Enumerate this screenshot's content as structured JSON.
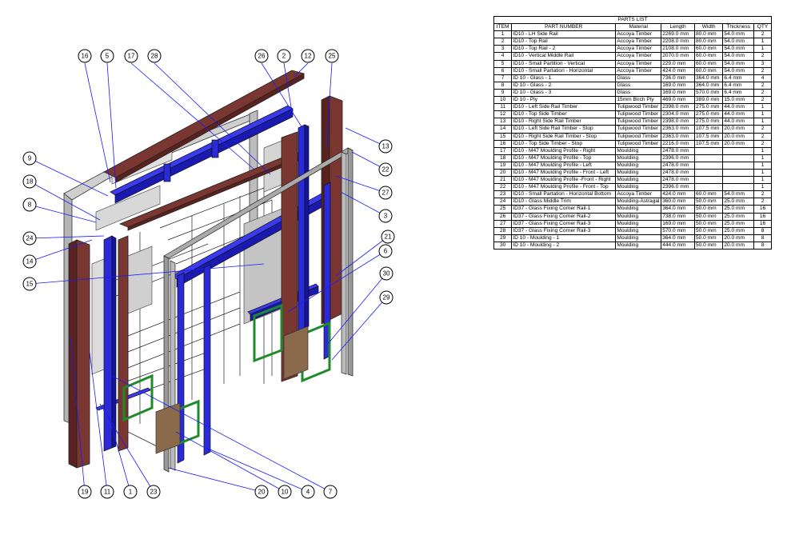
{
  "parts_list": {
    "title": "PARTS LIST",
    "columns": [
      "ITEM",
      "PART NUMBER",
      "Material",
      "Length",
      "Width",
      "Thickness",
      "QTY"
    ],
    "rows": [
      [
        "1",
        "ID10 - LH Side Rail",
        "Accoya Timber",
        "2269.0 mm",
        "80.0 mm",
        "54.0 mm",
        "2"
      ],
      [
        "2",
        "ID10 - Top Rail",
        "Accoya Timber",
        "2208.0 mm",
        "80.0 mm",
        "54.0 mm",
        "1"
      ],
      [
        "3",
        "ID10 - Top Rail - 2",
        "Accoya Timber",
        "2108.0 mm",
        "60.0 mm",
        "54.0 mm",
        "1"
      ],
      [
        "4",
        "ID10 - Vertical Middle Rail",
        "Accoya Timber",
        "2070.0 mm",
        "60.0 mm",
        "54.0 mm",
        "2"
      ],
      [
        "5",
        "ID10 - Small Partition - Vertical",
        "Accoya Timber",
        "229.0 mm",
        "60.0 mm",
        "54.0 mm",
        "3"
      ],
      [
        "6",
        "ID10 - Small Partation - Horizontal",
        "Accoya Timber",
        "424.0 mm",
        "60.0 mm",
        "54.0 mm",
        "2"
      ],
      [
        "7",
        "ID 10 - Glass - 1",
        "Glass",
        "736.0 mm",
        "364.0 mm",
        "6.4 mm",
        "4"
      ],
      [
        "8",
        "ID 10 - Glass - 2",
        "Glass",
        "169.0 mm",
        "364.0 mm",
        "6.4 mm",
        "2"
      ],
      [
        "9",
        "ID 10 - Glass - 3",
        "Glass",
        "169.0 mm",
        "570.0 mm",
        "6.4 mm",
        "2"
      ],
      [
        "10",
        "ID 10 - Ply",
        "15mm Birch Ply",
        "469.0 mm",
        "389.0 mm",
        "15.0 mm",
        "2"
      ],
      [
        "11",
        "ID10 - Left Side Rail Timber",
        "Tulipwood Timber",
        "2398.0 mm",
        "275.0 mm",
        "44.0 mm",
        "1"
      ],
      [
        "12",
        "ID10 - Top Side Timber",
        "Tulipwood Timber",
        "2304.0 mm",
        "275.0 mm",
        "44.0 mm",
        "1"
      ],
      [
        "13",
        "ID10 - Right Side Rail Timber",
        "Tulipwood Timber",
        "2398.0 mm",
        "275.0 mm",
        "44.0 mm",
        "1"
      ],
      [
        "14",
        "ID10 - Left Side Rail Timber - Stop",
        "Tulipwood Timber",
        "2363.0 mm",
        "107.5 mm",
        "20.0 mm",
        "2"
      ],
      [
        "15",
        "ID10 - Right Side Rail Timber - Stop",
        "Tulipwood Timber",
        "2363.0 mm",
        "107.5 mm",
        "20.0 mm",
        "2"
      ],
      [
        "16",
        "ID10 - Top Side Timber - Stop",
        "Tulipwood Timber",
        "2216.0 mm",
        "107.5 mm",
        "20.0 mm",
        "2"
      ],
      [
        "17",
        "ID10 - M47 Moulding Profile - Right",
        "Moulding",
        "2478.0 mm",
        "",
        "",
        "1"
      ],
      [
        "18",
        "ID10 - M47 Moulding Profile - Top",
        "Moulding",
        "2396.0 mm",
        "",
        "",
        "1"
      ],
      [
        "19",
        "ID10 - M47 Moulding Profile - Left",
        "Moulding",
        "2478.0 mm",
        "",
        "",
        "1"
      ],
      [
        "20",
        "ID10 - M47 Moulding Profile - Front - Left",
        "Moulding",
        "2478.0 mm",
        "",
        "",
        "1"
      ],
      [
        "21",
        "ID10 - M47 Moulding Profile -Front - Right",
        "Moulding",
        "2478.0 mm",
        "",
        "",
        "1"
      ],
      [
        "22",
        "ID10 - M47 Moulding Profile - Front - Top",
        "Moulding",
        "2396.0 mm",
        "",
        "",
        "1"
      ],
      [
        "23",
        "ID10 - Small Partation - Horizontal Bottom",
        "Accoya Timber",
        "424.0 mm",
        "60.0 mm",
        "54.0 mm",
        "2"
      ],
      [
        "24",
        "ID10 - Glass Middle Trim",
        "Moulding-Astragal",
        "360.0 mm",
        "50.0 mm",
        "25.0 mm",
        "2"
      ],
      [
        "25",
        "ID37 - Glass Fixing Corner Rail-1",
        "Moulding",
        "364.0 mm",
        "50.0 mm",
        "25.0 mm",
        "16"
      ],
      [
        "26",
        "ID37 - Glass Fixing Corner Rail-2",
        "Moulding",
        "738.0 mm",
        "50.0 mm",
        "25.0 mm",
        "16"
      ],
      [
        "27",
        "ID37 - Glass Fixing Corner Rail-3",
        "Moulding",
        "169.0 mm",
        "50.0 mm",
        "25.0 mm",
        "16"
      ],
      [
        "28",
        "ID37 - Glass Fixing Corner Rail-3",
        "Moulding",
        "570.0 mm",
        "50.0 mm",
        "25.0 mm",
        "8"
      ],
      [
        "29",
        "ID 10 - Moulding - 1",
        "Moulding",
        "364.0 mm",
        "50.0 mm",
        "20.0 mm",
        "8"
      ],
      [
        "30",
        "ID 10 - Moulding - 2",
        "Moulding",
        "444.0 mm",
        "50.0 mm",
        "20.0 mm",
        "8"
      ]
    ]
  },
  "balloons": [
    "16",
    "5",
    "17",
    "28",
    "26",
    "2",
    "12",
    "25",
    "9",
    "18",
    "8",
    "24",
    "14",
    "15",
    "13",
    "22",
    "27",
    "3",
    "21",
    "6",
    "30",
    "29",
    "19",
    "11",
    "1",
    "23",
    "20",
    "10",
    "4",
    "7"
  ],
  "colors": {
    "timber": "#6b2a26",
    "accoya": "#2a2ad6",
    "moulding_green": "#1f8a2a",
    "ply": "#8a6a4a",
    "glass": "#c8c8c8",
    "frame_gray": "#9a9a9a",
    "leader": "#1a1aff"
  }
}
